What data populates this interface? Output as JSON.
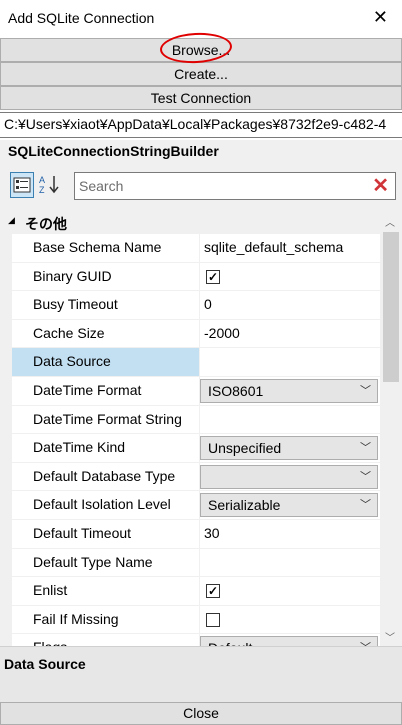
{
  "window": {
    "title": "Add SQLite Connection"
  },
  "buttons": {
    "browse": "Browse...",
    "create": "Create...",
    "test": "Test Connection",
    "close": "Close"
  },
  "path": "C:¥Users¥xiaot¥AppData¥Local¥Packages¥8732f2e9-c482-4",
  "grid": {
    "object_name": "SQLiteConnectionStringBuilder",
    "search_placeholder": "Search",
    "category": "その他",
    "rows": [
      {
        "name": "Base Schema Name",
        "value": "sqlite_default_schema"
      },
      {
        "name": "Binary GUID",
        "value": "✓"
      },
      {
        "name": "Busy Timeout",
        "value": "0"
      },
      {
        "name": "Cache Size",
        "value": "-2000"
      },
      {
        "name": "Data Source",
        "value": ""
      },
      {
        "name": "DateTime Format",
        "value": "ISO8601"
      },
      {
        "name": "DateTime Format String",
        "value": ""
      },
      {
        "name": "DateTime Kind",
        "value": "Unspecified"
      },
      {
        "name": "Default Database Type",
        "value": ""
      },
      {
        "name": "Default Isolation Level",
        "value": "Serializable"
      },
      {
        "name": "Default Timeout",
        "value": "30"
      },
      {
        "name": "Default Type Name",
        "value": ""
      },
      {
        "name": "Enlist",
        "value": "✓"
      },
      {
        "name": "Fail If Missing",
        "value": ""
      },
      {
        "name": "Flags",
        "value": "Default"
      }
    ]
  },
  "description": {
    "title": "Data Source"
  },
  "colors": {
    "annotation_circle": "#e00000",
    "selected_row": "#c3e0f3",
    "clear_icon": "#d13438"
  }
}
